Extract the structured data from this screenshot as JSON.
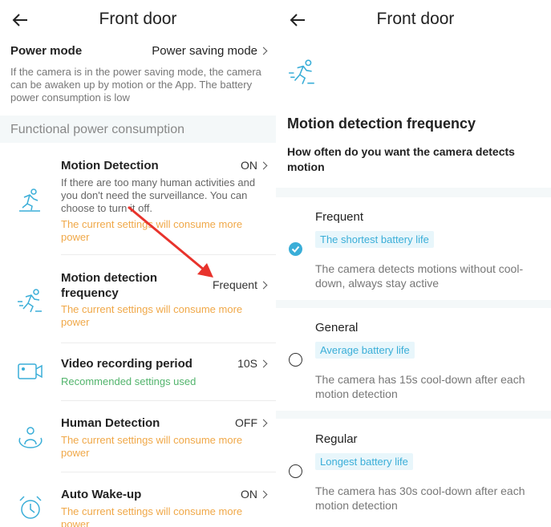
{
  "left": {
    "title": "Front door",
    "power_mode": {
      "label": "Power mode",
      "value": "Power saving mode",
      "desc": "If the camera is in the power saving mode, the camera can be awaken up by motion or the App. The battery power consumption is low"
    },
    "section_title": "Functional power consumption",
    "items": [
      {
        "title": "Motion Detection",
        "value": "ON",
        "desc": "If there are too many human activities and you don't need the surveillance. You can choose to turn it off.",
        "note": "The current settings will consume more power",
        "icon": "running-person-icon"
      },
      {
        "title": "Motion detection frequency",
        "value": "Frequent",
        "note": "The current settings will consume more power",
        "icon": "sprinting-person-icon"
      },
      {
        "title": "Video recording period",
        "value": "10S",
        "note": "Recommended settings used",
        "icon": "video-camera-icon"
      },
      {
        "title": "Human Detection",
        "value": "OFF",
        "note": "The current settings will consume more power",
        "icon": "person-detect-icon"
      },
      {
        "title": "Auto Wake-up",
        "value": "ON",
        "note": "The current settings will consume more power",
        "icon": "alarm-clock-icon"
      }
    ]
  },
  "right": {
    "title": "Front door",
    "heading": "Motion detection frequency",
    "question": "How often do you want the camera detects motion",
    "options": [
      {
        "label": "Frequent",
        "tag": "The shortest battery life",
        "desc": "The camera detects motions without cool-down, always stay active",
        "selected": true
      },
      {
        "label": "General",
        "tag": "Average battery life",
        "desc": "The camera has 15s cool-down after each motion detection",
        "selected": false
      },
      {
        "label": "Regular",
        "tag": "Longest battery life",
        "desc": "The camera has 30s cool-down after each motion detection",
        "selected": false
      }
    ]
  },
  "colors": {
    "accent": "#3aaed8",
    "warning": "#f0a848",
    "ok": "#52b46c",
    "arrow": "#e8332c"
  }
}
